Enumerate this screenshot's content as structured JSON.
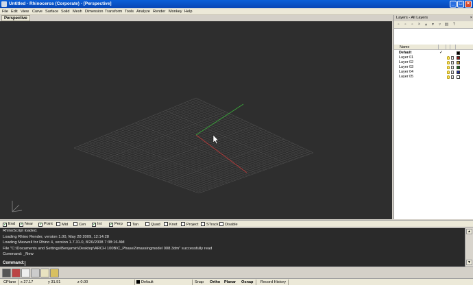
{
  "window": {
    "title": "Untitled - Rhinoceros (Corporate) - [Perspective]",
    "minimize": "_",
    "maximize": "□",
    "close": "×"
  },
  "menu": [
    "File",
    "Edit",
    "View",
    "Curve",
    "Surface",
    "Solid",
    "Mesh",
    "Dimension",
    "Transform",
    "Tools",
    "Analyze",
    "Render",
    "Monkey",
    "Help"
  ],
  "viewport": {
    "tab_label": "Perspective"
  },
  "layers_panel": {
    "title": "Layers - All Layers",
    "close": "×",
    "column_name": "Name",
    "layers": [
      {
        "name": "Default",
        "current": true,
        "check": "✓",
        "color": "#000000"
      },
      {
        "name": "Layer 01",
        "current": false,
        "color": "#8b1a1a"
      },
      {
        "name": "Layer 02",
        "current": false,
        "color": "#b79a3a"
      },
      {
        "name": "Layer 03",
        "current": false,
        "color": "#1f6a1f"
      },
      {
        "name": "Layer 04",
        "current": false,
        "color": "#1f2f9a"
      },
      {
        "name": "Layer 05",
        "current": false,
        "color": "#ffffff"
      }
    ]
  },
  "osnap": [
    {
      "label": "End",
      "checked": true
    },
    {
      "label": "Near",
      "checked": true
    },
    {
      "label": "Point",
      "checked": true
    },
    {
      "label": "Mid",
      "checked": false
    },
    {
      "label": "Cen",
      "checked": false
    },
    {
      "label": "Int",
      "checked": true
    },
    {
      "label": "Perp",
      "checked": true
    },
    {
      "label": "Tan",
      "checked": false
    },
    {
      "label": "Quad",
      "checked": false
    },
    {
      "label": "Knot",
      "checked": false
    },
    {
      "label": "Project",
      "checked": false
    },
    {
      "label": "STrack",
      "checked": false
    },
    {
      "label": "Disable",
      "checked": false
    }
  ],
  "history": [
    "RhinoScript loaded.",
    "Loading Rhino Render, version 1.00, May 28 2009, 12:14:28",
    "Loading Maxwell for Rhino 4, version 1.7.31.0, 8/20/2008 7:38:16 AM",
    "File \"C:\\Documents and Settings\\Benjamin\\Desktop\\ARCH 100B\\C_Phase2\\massingmodel 008.3dm\" successfully read",
    "Command: _New"
  ],
  "command": {
    "label": "Command:"
  },
  "status": {
    "cplane": "CPlane",
    "x": "x 27.17",
    "y": "y 31.91",
    "z": "z 0.00",
    "layer": "Default",
    "snap": "Snap",
    "ortho": "Ortho",
    "planar": "Planar",
    "osnap": "Osnap",
    "record_history": "Record History"
  },
  "colors": {
    "viewport_bg": "#2e2e2e",
    "grid": "#4a4a4a",
    "x_axis": "#b03a3a",
    "y_axis": "#3aa53a",
    "title_bar": "#0a5fd8"
  }
}
